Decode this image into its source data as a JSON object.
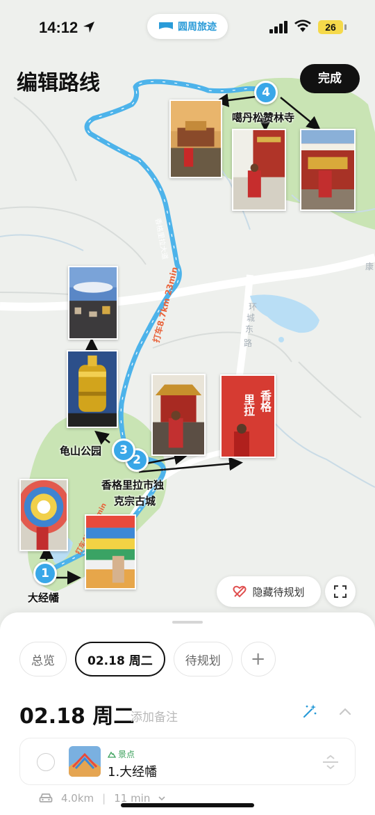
{
  "status_bar": {
    "time": "14:12",
    "battery": "26"
  },
  "app_pill": {
    "name": "圆周旅迹"
  },
  "header": {
    "title": "编辑路线",
    "done_label": "完成"
  },
  "map": {
    "markers": [
      "1",
      "2",
      "3",
      "4"
    ],
    "place_labels": {
      "p1": "大经幡",
      "p2_line1": "香格里拉市独",
      "p2_line2": "克宗古城",
      "p3": "龟山公园",
      "p4": "噶丹松赞林寺"
    },
    "road_labels": {
      "ring_east_1": "环",
      "ring_east_2": "城",
      "ring_east_3": "东",
      "ring_east_4": "路",
      "road_right": "康",
      "road_route": "香格里拉大道"
    },
    "route_labels": {
      "leg_short": "打车4km 11min",
      "leg_long": "打车8.7km 23min"
    },
    "photo_sign_text": {
      "line1": "香格",
      "line2": "里拉"
    },
    "hide_button_label": "隐藏待规划"
  },
  "sheet": {
    "tabs": [
      {
        "label": "总览",
        "active": false
      },
      {
        "label": "02.18 周二",
        "active": true
      },
      {
        "label": "待规划",
        "active": false
      }
    ],
    "add_tab_label": "+",
    "day_title": "02.18 周二",
    "add_note_label": "添加备注",
    "poi": {
      "category": "景点",
      "name": "1.大经幡"
    },
    "travel": {
      "distance": "4.0km",
      "duration": "11 min"
    }
  },
  "colors": {
    "route": "#4db3ea",
    "marker": "#39a7e8",
    "park": "#c9e4b4",
    "accent_blue": "#2a9bd8",
    "green_text": "#3aa05a"
  }
}
